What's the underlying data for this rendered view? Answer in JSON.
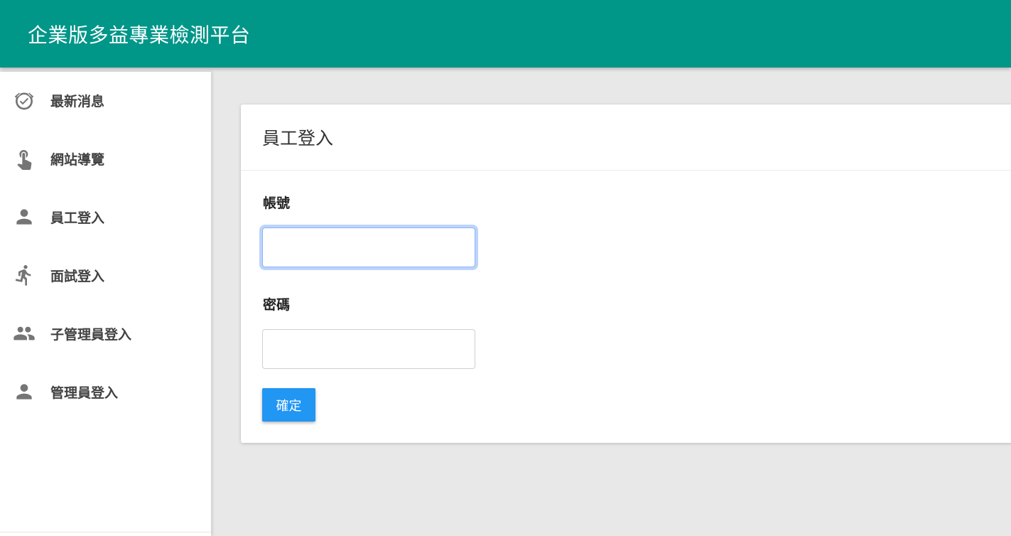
{
  "header": {
    "title": "企業版多益專業檢測平台",
    "color": "#009688"
  },
  "sidebar": {
    "items": [
      {
        "label": "最新消息",
        "icon": "alarm-check-icon"
      },
      {
        "label": "網站導覽",
        "icon": "touch-hand-icon"
      },
      {
        "label": "員工登入",
        "icon": "person-icon"
      },
      {
        "label": "面試登入",
        "icon": "running-person-icon"
      },
      {
        "label": "子管理員登入",
        "icon": "people-icon"
      },
      {
        "label": "管理員登入",
        "icon": "person-icon"
      }
    ]
  },
  "login_card": {
    "title": "員工登入",
    "account_label": "帳號",
    "account_value": "",
    "password_label": "密碼",
    "password_value": "",
    "submit_label": "確定",
    "submit_color": "#2196f3"
  }
}
